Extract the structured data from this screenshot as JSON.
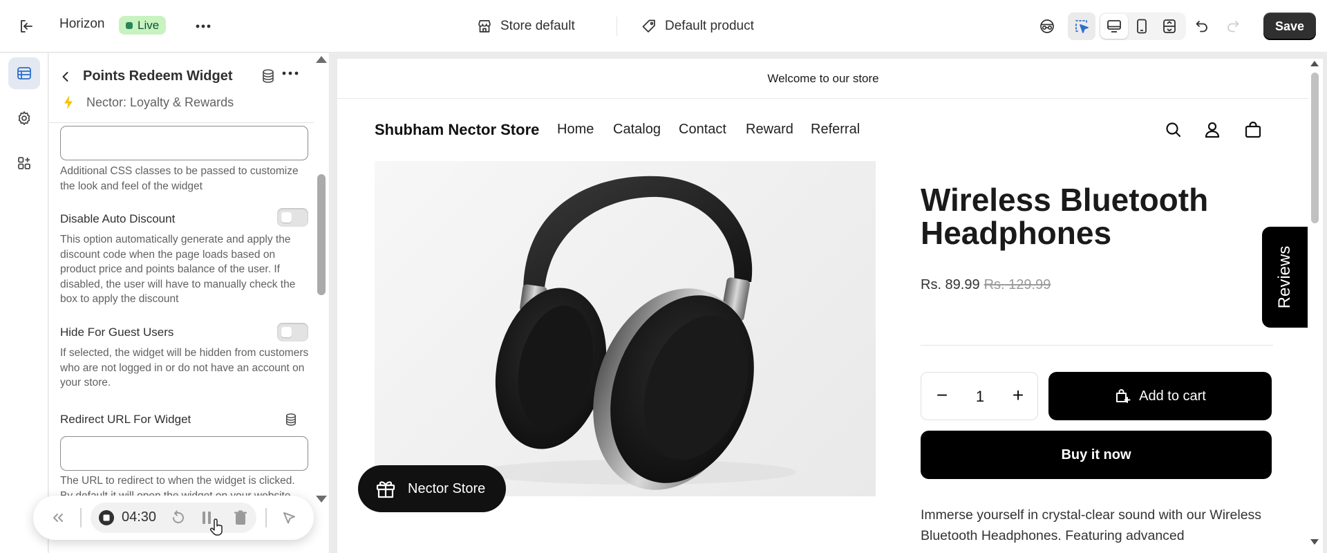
{
  "topbar": {
    "app_name": "Horizon",
    "status_badge": "Live",
    "context_store": "Store default",
    "context_product": "Default product",
    "save_label": "Save"
  },
  "panel": {
    "title": "Points Redeem Widget",
    "subtitle": "Nector: Loyalty & Rewards",
    "css_help": "Additional CSS classes to be passed to customize the look and feel of the widget",
    "disable_auto_discount_label": "Disable Auto Discount",
    "disable_auto_discount_help": "This option automatically generate and apply the discount code when the page loads based on product price and points balance of the user. If disabled, the user will have to manually check the box to apply the discount",
    "disable_auto_discount_on": false,
    "hide_guest_label": "Hide For Guest Users",
    "hide_guest_help": "If selected, the widget will be hidden from customers who are not logged in or do not have an account on your store.",
    "hide_guest_on": false,
    "redirect_label": "Redirect URL For Widget",
    "redirect_help": "The URL to redirect to when the widget is clicked. By default it will open the widget on your website"
  },
  "recorder": {
    "time": "04:30"
  },
  "preview": {
    "announcement": "Welcome to our store",
    "store_name": "Shubham Nector Store",
    "nav": [
      "Home",
      "Catalog",
      "Contact",
      "Reward",
      "Referral"
    ],
    "product_title": "Wireless Bluetooth Headphones",
    "price": "Rs. 89.99",
    "compare_price": "Rs. 129.99",
    "quantity": "1",
    "add_to_cart": "Add to cart",
    "buy_now": "Buy it now",
    "description": "Immerse yourself in crystal-clear sound with our Wireless Bluetooth Headphones. Featuring advanced",
    "nector_button": "Nector Store",
    "reviews_tab": "Reviews"
  },
  "icons": {
    "exit": "exit-icon",
    "more": "more-horizontal-icon",
    "store": "store-icon",
    "tag": "tag-icon",
    "inspector": "inspector-icon",
    "select": "cursor-select-icon",
    "desktop": "desktop-icon",
    "mobile": "mobile-icon",
    "fullwidth": "full-width-icon",
    "undo": "undo-icon",
    "redo": "redo-icon"
  },
  "colors": {
    "live_badge_bg": "#c9f2c1",
    "live_badge_text": "#0c5132",
    "rail_active": "#2c6ecb",
    "save_bg": "#303030",
    "nector_bolt": "#f5c400"
  }
}
